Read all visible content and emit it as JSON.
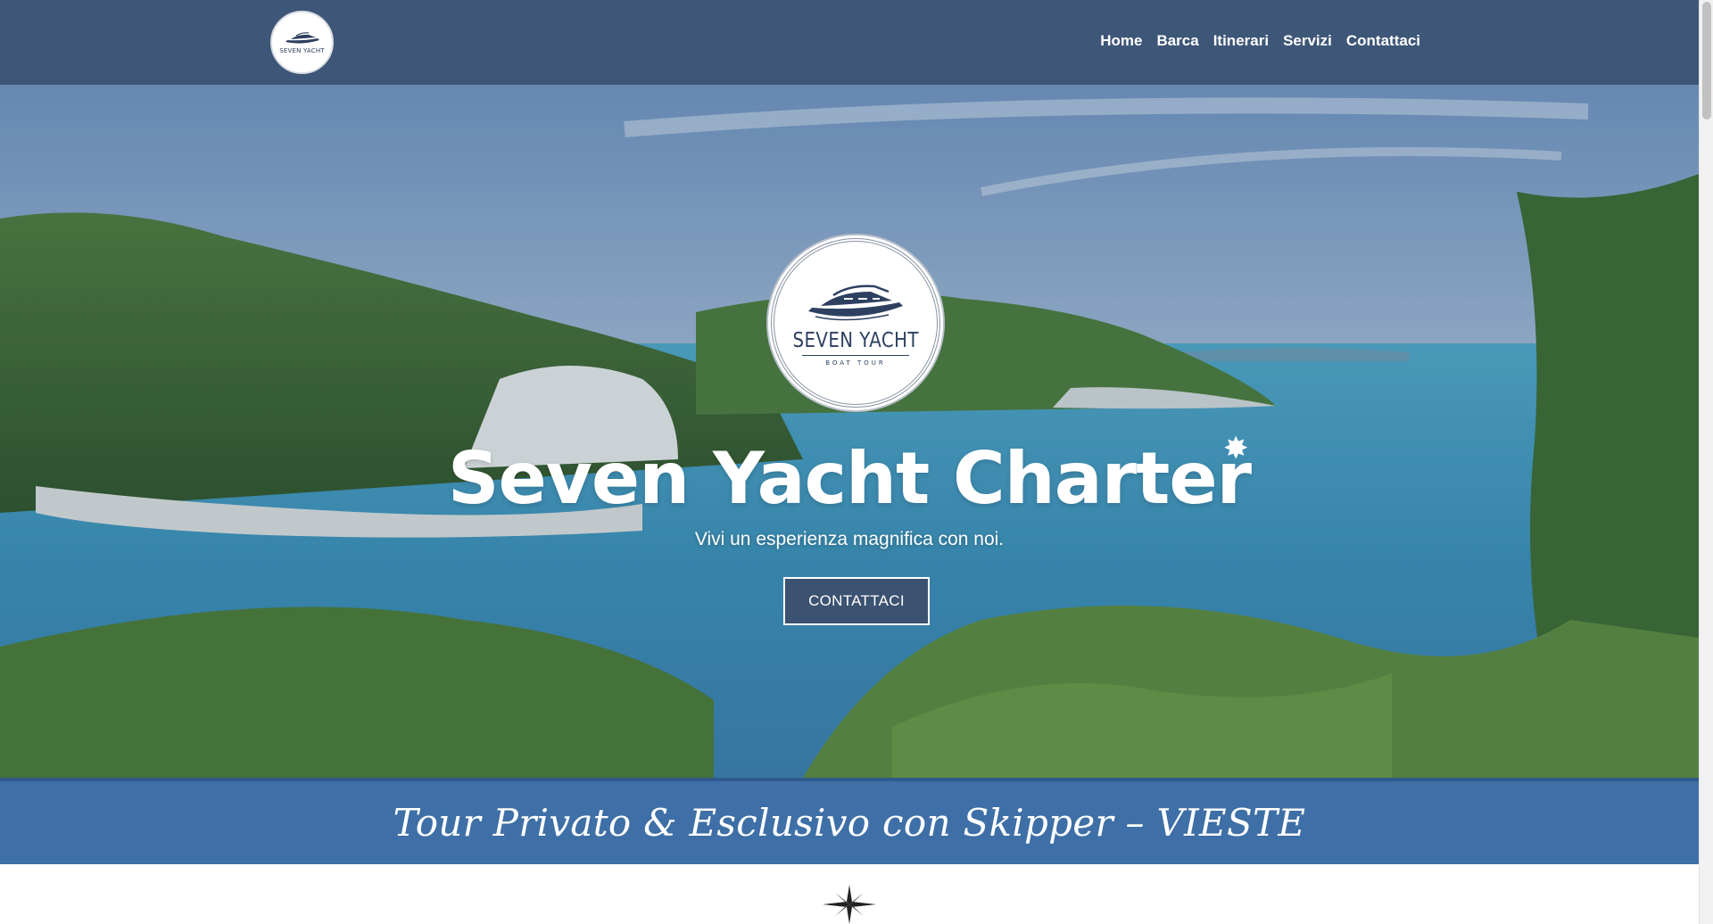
{
  "header": {
    "logo_text": "SEVEN YACHT",
    "nav": [
      "Home",
      "Barca",
      "Itinerari",
      "Servizi",
      "Contattaci"
    ]
  },
  "hero": {
    "badge_brand": "SEVEN YACHT",
    "badge_sub": "BOAT TOUR",
    "title": "Seven Yacht Charter",
    "subtitle": "Vivi un esperienza magnifica con noi.",
    "cta": "CONTATTACI"
  },
  "banner": {
    "text": "Tour Privato & Esclusivo con Skipper – VIESTE"
  },
  "colors": {
    "header": "#3e5677",
    "banner": "#3e6fa6",
    "button": "#3b5271",
    "brand": "#2d4060"
  },
  "icons": [
    "boat-logo-icon",
    "sparkle-icon",
    "compass-rose-icon"
  ]
}
